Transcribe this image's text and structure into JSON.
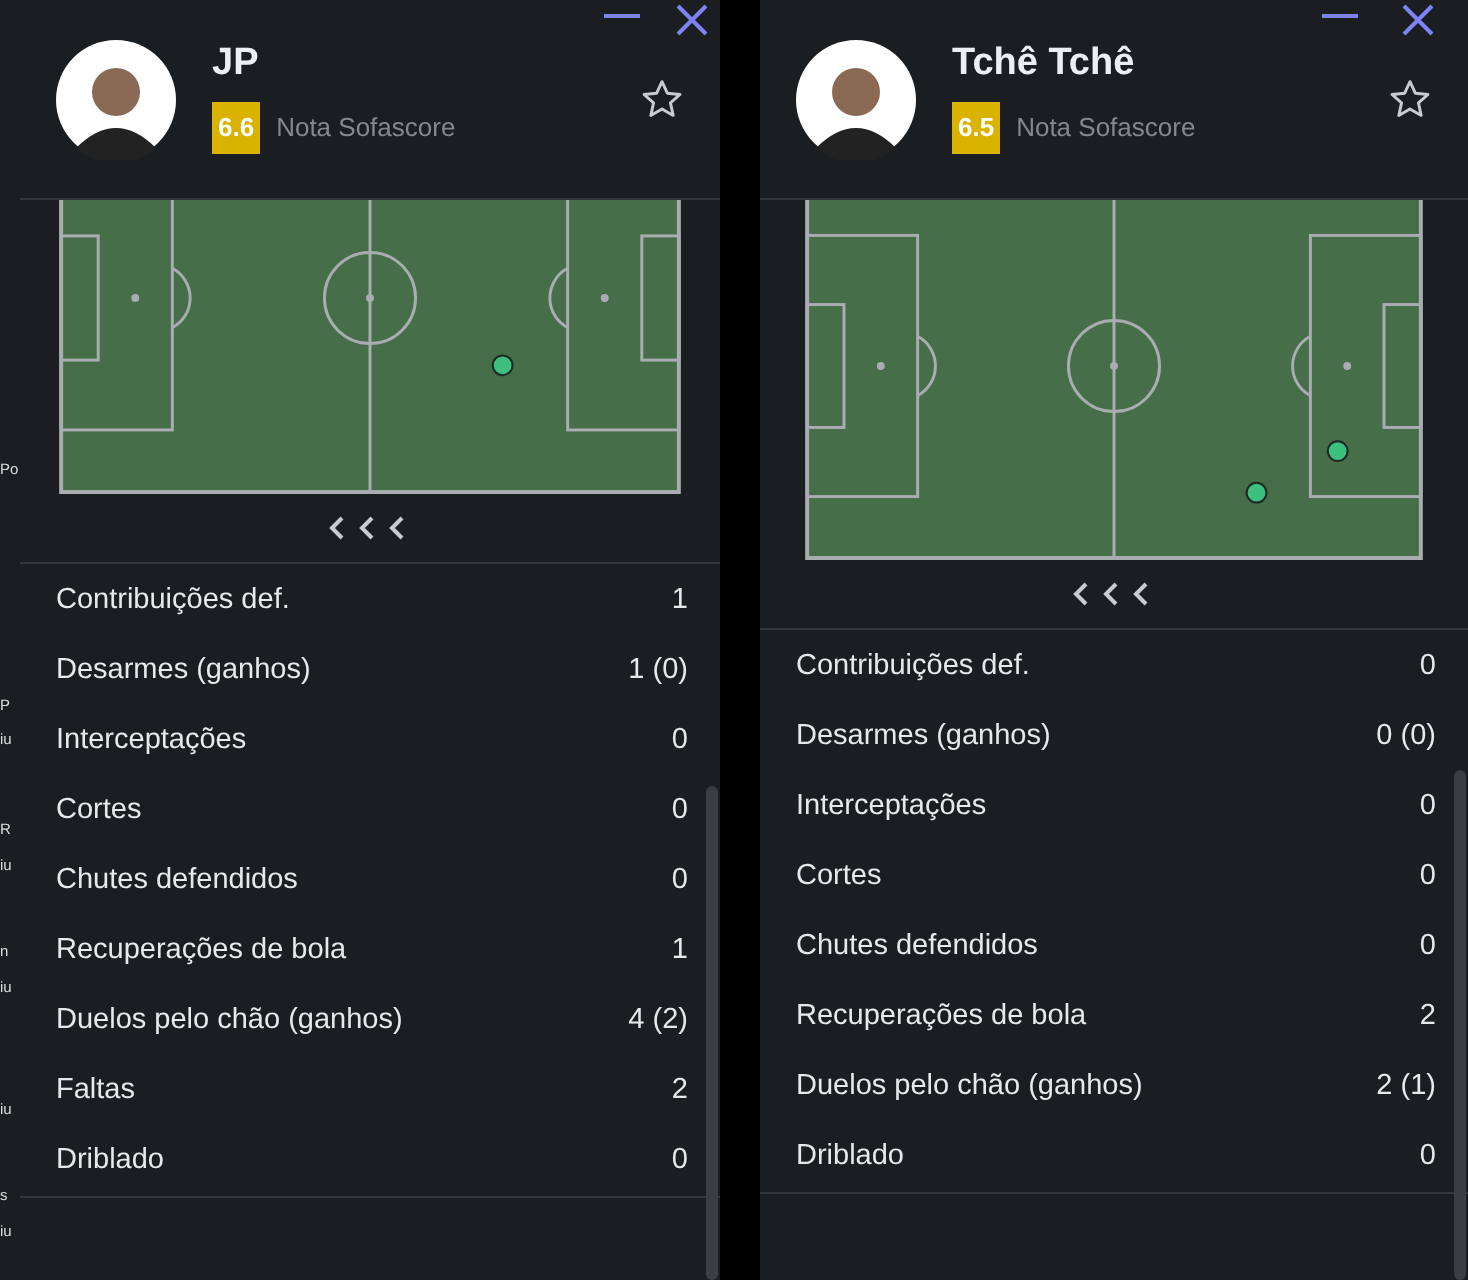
{
  "background_fragments": [
    "Po",
    "P",
    "iu",
    "R",
    "iu",
    "n",
    "iu",
    "iu",
    "s",
    "iu"
  ],
  "panels": [
    {
      "player": "JP",
      "rating": "6.6",
      "rating_label": "Nota Sofascore",
      "favorite": false,
      "stats": [
        {
          "label": "Contribuições def.",
          "value": "1"
        },
        {
          "label": "Desarmes (ganhos)",
          "value": "1 (0)"
        },
        {
          "label": "Interceptações",
          "value": "0"
        },
        {
          "label": "Cortes",
          "value": "0"
        },
        {
          "label": "Chutes defendidos",
          "value": "0"
        },
        {
          "label": "Recuperações de bola",
          "value": "1"
        },
        {
          "label": "Duelos pelo chão (ganhos)",
          "value": "4 (2)"
        },
        {
          "label": "Faltas",
          "value": "2"
        },
        {
          "label": "Driblado",
          "value": "0"
        }
      ]
    },
    {
      "player": "Tchê Tchê",
      "rating": "6.5",
      "rating_label": "Nota Sofascore",
      "favorite": false,
      "stats": [
        {
          "label": "Contribuições def.",
          "value": "0"
        },
        {
          "label": "Desarmes (ganhos)",
          "value": "0 (0)"
        },
        {
          "label": "Interceptações",
          "value": "0"
        },
        {
          "label": "Cortes",
          "value": "0"
        },
        {
          "label": "Chutes defendidos",
          "value": "0"
        },
        {
          "label": "Recuperações de bola",
          "value": "2"
        },
        {
          "label": "Duelos pelo chão (ganhos)",
          "value": "2 (1)"
        },
        {
          "label": "Driblado",
          "value": "0"
        }
      ]
    }
  ]
}
